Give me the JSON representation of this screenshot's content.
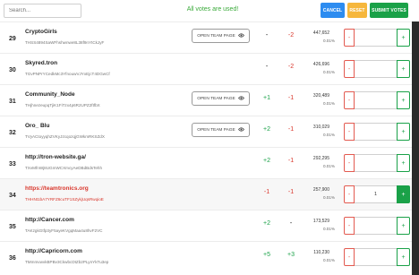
{
  "toolbar": {
    "search_placeholder": "Search...",
    "status_message": "All votes are used!",
    "cancel_label": "CANCEL",
    "reset_label": "RESET",
    "submit_label": "SUBMIT VOTES"
  },
  "team_page_label": "OPEN TEAM PAGE",
  "rows": [
    {
      "rank": "29",
      "name": "CryptoGirls",
      "address": "THSS4894SaWFhshwnwe8L38f9nYtCkJyF",
      "delta1": "-",
      "delta2": "-2",
      "votes": "447,652",
      "pct": "0.01%",
      "vote_value": "",
      "has_team": true,
      "highlight": false,
      "red": false
    },
    {
      "rank": "30",
      "name": "Skyred.tron",
      "address": "TGvPNPrYCedkMc3YfnouwVJYxEjcT4DGwCf",
      "delta1": "-",
      "delta2": "-2",
      "votes": "426,696",
      "pct": "0.01%",
      "vote_value": "",
      "has_team": false,
      "highlight": false,
      "red": false
    },
    {
      "rank": "31",
      "name": "Community_Node",
      "address": "THjhnezeupqTjiK1FiTzx4p6R2UPZ2ftfbX",
      "delta1": "+1",
      "delta2": "-1",
      "votes": "320,489",
      "pct": "0.01%",
      "vote_value": "",
      "has_team": true,
      "highlight": false,
      "red": false
    },
    {
      "rank": "32",
      "name": "Oro_ Blu",
      "address": "TVyACtoyyqhZVKyJzcqozqjGWkmRKSZdX",
      "delta1": "+2",
      "delta2": "-1",
      "votes": "310,029",
      "pct": "0.01%",
      "vote_value": "",
      "has_team": true,
      "highlight": false,
      "red": false
    },
    {
      "rank": "33",
      "name": "http://tron-website.ga/",
      "address": "TXvMfnWj8UGmWCXmcyAeDBdBdsTehh",
      "delta1": "+2",
      "delta2": "-1",
      "votes": "292,295",
      "pct": "0.01%",
      "vote_value": "",
      "has_team": false,
      "highlight": false,
      "red": false
    },
    {
      "rank": "34",
      "name": "https://teamtronics.org",
      "address": "THHNt1bA7YRFZ6cuTF1SZykjUqsRwqioE",
      "delta1": "-1",
      "delta2": "-1",
      "votes": "257,900",
      "pct": "0.01%",
      "vote_value": "1",
      "has_team": false,
      "highlight": true,
      "red": true
    },
    {
      "rank": "35",
      "name": "http://Cancer.com",
      "address": "TAKzgkGtfp3yF5ayeKVgqMaa4u8hvF2VC",
      "delta1": "+2",
      "delta2": "-",
      "votes": "173,529",
      "pct": "0.01%",
      "vote_value": "",
      "has_team": false,
      "highlight": false,
      "red": false
    },
    {
      "rank": "36",
      "name": "http://Capricorn.com",
      "address": "TMmmvwvkBPBv3CkwbcDtZb2PLynYkTu3ep",
      "delta1": "+5",
      "delta2": "+3",
      "votes": "110,230",
      "pct": "0.01%",
      "vote_value": "",
      "has_team": false,
      "highlight": false,
      "red": false
    }
  ]
}
